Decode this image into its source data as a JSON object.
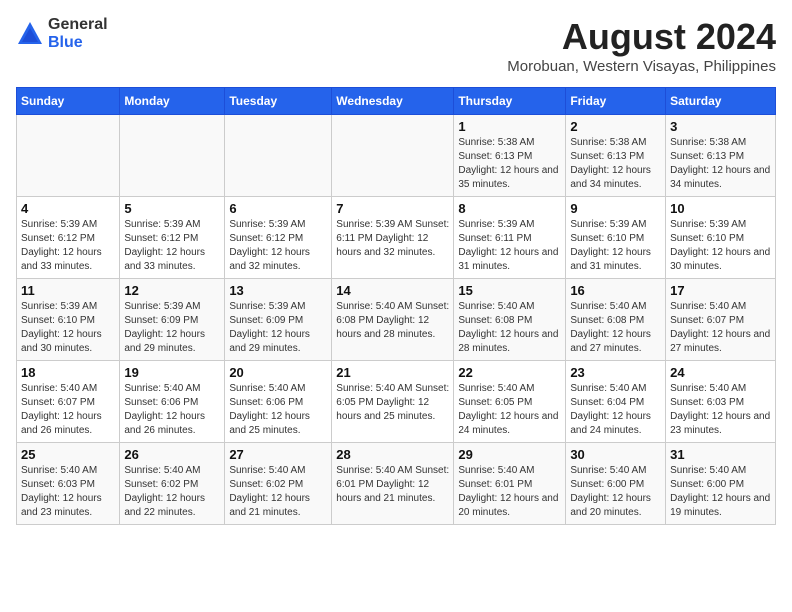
{
  "header": {
    "logo": {
      "general": "General",
      "blue": "Blue"
    },
    "title": "August 2024",
    "subtitle": "Morobuan, Western Visayas, Philippines"
  },
  "calendar": {
    "weekdays": [
      "Sunday",
      "Monday",
      "Tuesday",
      "Wednesday",
      "Thursday",
      "Friday",
      "Saturday"
    ],
    "weeks": [
      {
        "days": [
          {
            "number": "",
            "info": ""
          },
          {
            "number": "",
            "info": ""
          },
          {
            "number": "",
            "info": ""
          },
          {
            "number": "",
            "info": ""
          },
          {
            "number": "1",
            "info": "Sunrise: 5:38 AM\nSunset: 6:13 PM\nDaylight: 12 hours\nand 35 minutes."
          },
          {
            "number": "2",
            "info": "Sunrise: 5:38 AM\nSunset: 6:13 PM\nDaylight: 12 hours\nand 34 minutes."
          },
          {
            "number": "3",
            "info": "Sunrise: 5:38 AM\nSunset: 6:13 PM\nDaylight: 12 hours\nand 34 minutes."
          }
        ]
      },
      {
        "days": [
          {
            "number": "4",
            "info": "Sunrise: 5:39 AM\nSunset: 6:12 PM\nDaylight: 12 hours\nand 33 minutes."
          },
          {
            "number": "5",
            "info": "Sunrise: 5:39 AM\nSunset: 6:12 PM\nDaylight: 12 hours\nand 33 minutes."
          },
          {
            "number": "6",
            "info": "Sunrise: 5:39 AM\nSunset: 6:12 PM\nDaylight: 12 hours\nand 32 minutes."
          },
          {
            "number": "7",
            "info": "Sunrise: 5:39 AM\nSunset: 6:11 PM\nDaylight: 12 hours\nand 32 minutes."
          },
          {
            "number": "8",
            "info": "Sunrise: 5:39 AM\nSunset: 6:11 PM\nDaylight: 12 hours\nand 31 minutes."
          },
          {
            "number": "9",
            "info": "Sunrise: 5:39 AM\nSunset: 6:10 PM\nDaylight: 12 hours\nand 31 minutes."
          },
          {
            "number": "10",
            "info": "Sunrise: 5:39 AM\nSunset: 6:10 PM\nDaylight: 12 hours\nand 30 minutes."
          }
        ]
      },
      {
        "days": [
          {
            "number": "11",
            "info": "Sunrise: 5:39 AM\nSunset: 6:10 PM\nDaylight: 12 hours\nand 30 minutes."
          },
          {
            "number": "12",
            "info": "Sunrise: 5:39 AM\nSunset: 6:09 PM\nDaylight: 12 hours\nand 29 minutes."
          },
          {
            "number": "13",
            "info": "Sunrise: 5:39 AM\nSunset: 6:09 PM\nDaylight: 12 hours\nand 29 minutes."
          },
          {
            "number": "14",
            "info": "Sunrise: 5:40 AM\nSunset: 6:08 PM\nDaylight: 12 hours\nand 28 minutes."
          },
          {
            "number": "15",
            "info": "Sunrise: 5:40 AM\nSunset: 6:08 PM\nDaylight: 12 hours\nand 28 minutes."
          },
          {
            "number": "16",
            "info": "Sunrise: 5:40 AM\nSunset: 6:08 PM\nDaylight: 12 hours\nand 27 minutes."
          },
          {
            "number": "17",
            "info": "Sunrise: 5:40 AM\nSunset: 6:07 PM\nDaylight: 12 hours\nand 27 minutes."
          }
        ]
      },
      {
        "days": [
          {
            "number": "18",
            "info": "Sunrise: 5:40 AM\nSunset: 6:07 PM\nDaylight: 12 hours\nand 26 minutes."
          },
          {
            "number": "19",
            "info": "Sunrise: 5:40 AM\nSunset: 6:06 PM\nDaylight: 12 hours\nand 26 minutes."
          },
          {
            "number": "20",
            "info": "Sunrise: 5:40 AM\nSunset: 6:06 PM\nDaylight: 12 hours\nand 25 minutes."
          },
          {
            "number": "21",
            "info": "Sunrise: 5:40 AM\nSunset: 6:05 PM\nDaylight: 12 hours\nand 25 minutes."
          },
          {
            "number": "22",
            "info": "Sunrise: 5:40 AM\nSunset: 6:05 PM\nDaylight: 12 hours\nand 24 minutes."
          },
          {
            "number": "23",
            "info": "Sunrise: 5:40 AM\nSunset: 6:04 PM\nDaylight: 12 hours\nand 24 minutes."
          },
          {
            "number": "24",
            "info": "Sunrise: 5:40 AM\nSunset: 6:03 PM\nDaylight: 12 hours\nand 23 minutes."
          }
        ]
      },
      {
        "days": [
          {
            "number": "25",
            "info": "Sunrise: 5:40 AM\nSunset: 6:03 PM\nDaylight: 12 hours\nand 23 minutes."
          },
          {
            "number": "26",
            "info": "Sunrise: 5:40 AM\nSunset: 6:02 PM\nDaylight: 12 hours\nand 22 minutes."
          },
          {
            "number": "27",
            "info": "Sunrise: 5:40 AM\nSunset: 6:02 PM\nDaylight: 12 hours\nand 21 minutes."
          },
          {
            "number": "28",
            "info": "Sunrise: 5:40 AM\nSunset: 6:01 PM\nDaylight: 12 hours\nand 21 minutes."
          },
          {
            "number": "29",
            "info": "Sunrise: 5:40 AM\nSunset: 6:01 PM\nDaylight: 12 hours\nand 20 minutes."
          },
          {
            "number": "30",
            "info": "Sunrise: 5:40 AM\nSunset: 6:00 PM\nDaylight: 12 hours\nand 20 minutes."
          },
          {
            "number": "31",
            "info": "Sunrise: 5:40 AM\nSunset: 6:00 PM\nDaylight: 12 hours\nand 19 minutes."
          }
        ]
      }
    ]
  }
}
